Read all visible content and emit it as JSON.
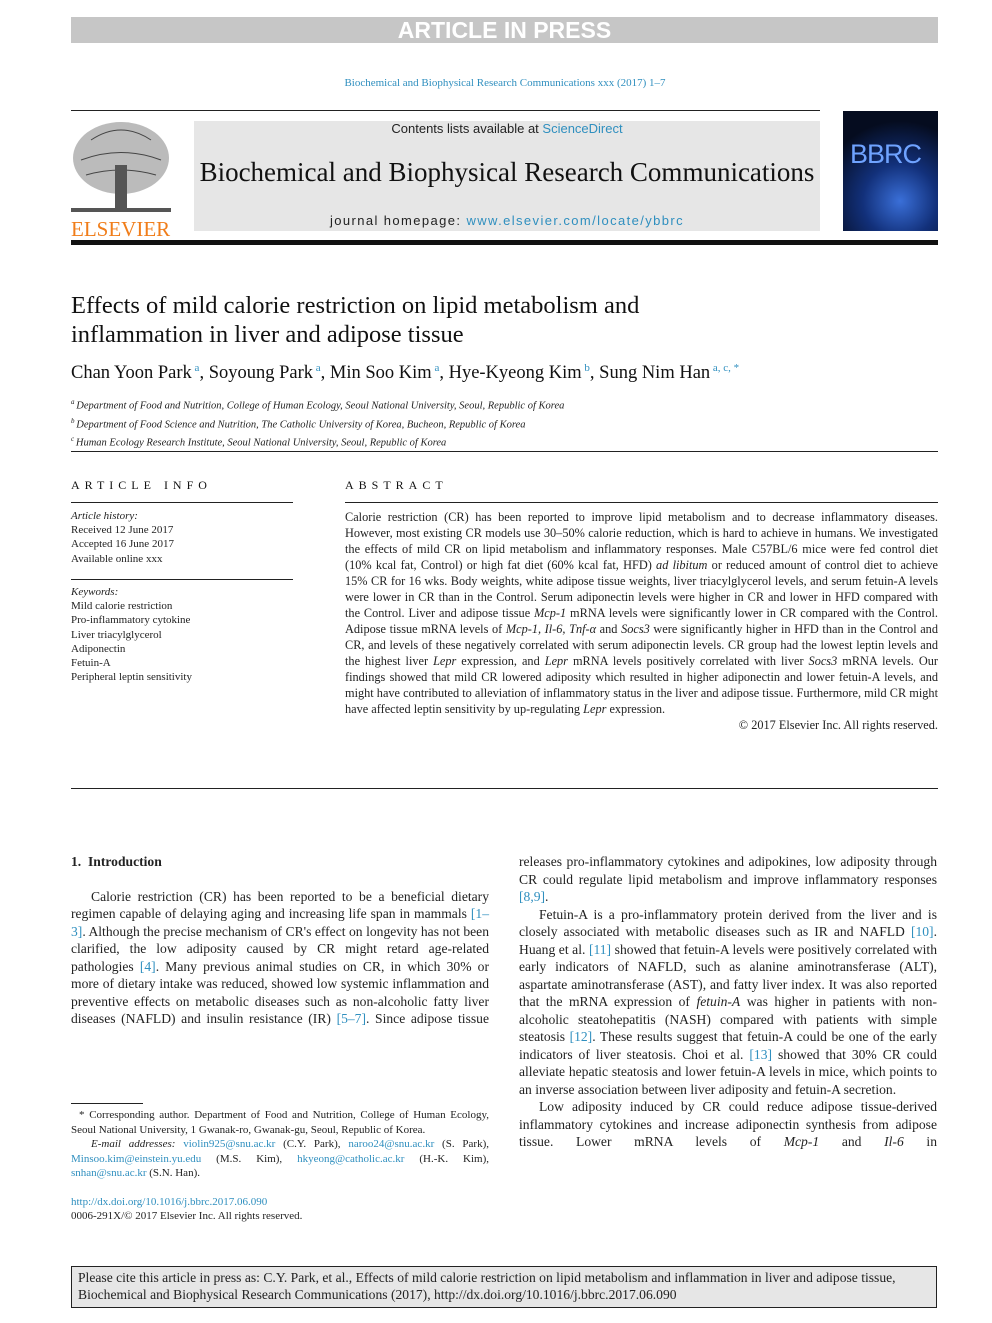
{
  "banner": {
    "article_in_press": "ARTICLE IN PRESS",
    "journal_ref": "Biochemical and Biophysical Research Communications xxx (2017) 1–7"
  },
  "masthead": {
    "contents_prefix": "Contents lists available at ",
    "sciencedirect": "ScienceDirect",
    "journal_title": "Biochemical and Biophysical Research Communications",
    "homepage_prefix": "journal homepage: ",
    "homepage_url": "www.elsevier.com/locate/ybbrc",
    "publisher_logo": "ELSEVIER",
    "cover_logo": "BBRC",
    "colors": {
      "link": "#2f8fbf",
      "elsevier": "#f07d1a"
    }
  },
  "article": {
    "title": "Effects of mild calorie restriction on lipid metabolism and inflammation in liver and adipose tissue",
    "authors": [
      {
        "name": "Chan Yoon Park",
        "aff": "a"
      },
      {
        "name": "Soyoung Park",
        "aff": "a"
      },
      {
        "name": "Min Soo Kim",
        "aff": "a"
      },
      {
        "name": "Hye-Kyeong Kim",
        "aff": "b"
      },
      {
        "name": "Sung Nim Han",
        "aff": "a, c, *"
      }
    ],
    "affiliations": [
      {
        "key": "a",
        "text": "Department of Food and Nutrition, College of Human Ecology, Seoul National University, Seoul, Republic of Korea"
      },
      {
        "key": "b",
        "text": "Department of Food Science and Nutrition, The Catholic University of Korea, Bucheon, Republic of Korea"
      },
      {
        "key": "c",
        "text": "Human Ecology Research Institute, Seoul National University, Seoul, Republic of Korea"
      }
    ]
  },
  "info": {
    "heading": "ARTICLE INFO",
    "history_label": "Article history:",
    "history": [
      "Received 12 June 2017",
      "Accepted 16 June 2017",
      "Available online xxx"
    ],
    "keywords_label": "Keywords:",
    "keywords": [
      "Mild calorie restriction",
      "Pro-inflammatory cytokine",
      "Liver triacylglycerol",
      "Adiponectin",
      "Fetuin-A",
      "Peripheral leptin sensitivity"
    ]
  },
  "abstract": {
    "heading": "ABSTRACT",
    "copyright": "© 2017 Elsevier Inc. All rights reserved.",
    "body": [
      [
        "t",
        "Calorie restriction (CR) has been reported to improve lipid metabolism and to decrease inflammatory diseases. However, most existing CR models use 30–50% calorie reduction, which is hard to achieve in humans. We investigated the effects of mild CR on lipid metabolism and inflammatory responses. Male C57BL/6 mice were fed control diet (10% kcal fat, Control) or high fat diet (60% kcal fat, HFD) "
      ],
      [
        "i",
        "ad libitum"
      ],
      [
        "t",
        " or reduced amount of control diet to achieve 15% CR for 16 wks. Body weights, white adipose tissue weights, liver triacylglycerol levels, and serum fetuin-A levels were lower in CR than in the Control. Serum adiponectin levels were higher in CR and lower in HFD compared with the Control. Liver and adipose tissue "
      ],
      [
        "i",
        "Mcp-1"
      ],
      [
        "t",
        " mRNA levels were significantly lower in CR compared with the Control. Adipose tissue mRNA levels of "
      ],
      [
        "i",
        "Mcp-1, Il-6, Tnf-α"
      ],
      [
        "t",
        " and "
      ],
      [
        "i",
        "Socs3"
      ],
      [
        "t",
        " were significantly higher in HFD than in the Control and CR, and levels of these negatively correlated with serum adiponectin levels. CR group had the lowest leptin levels and the highest liver "
      ],
      [
        "i",
        "Lepr"
      ],
      [
        "t",
        " expression, and "
      ],
      [
        "i",
        "Lepr"
      ],
      [
        "t",
        " mRNA levels positively correlated with liver "
      ],
      [
        "i",
        "Socs3"
      ],
      [
        "t",
        " mRNA levels. Our findings showed that mild CR lowered adiposity which resulted in higher adiponectin and lower fetuin-A levels, and might have contributed to alleviation of inflammatory status in the liver and adipose tissue. Furthermore, mild CR might have affected leptin sensitivity by up-regulating "
      ],
      [
        "i",
        "Lepr"
      ],
      [
        "t",
        " expression."
      ]
    ]
  },
  "intro": {
    "heading_num": "1.",
    "heading": "Introduction",
    "left_p1": [
      [
        "t",
        "Calorie restriction (CR) has been reported to be a beneficial dietary regimen capable of delaying aging and increasing life span in mammals "
      ],
      [
        "c",
        "[1–3]"
      ],
      [
        "t",
        ". Although the precise mechanism of CR's effect on longevity has not been clarified, the low adiposity caused by CR might retard age-related pathologies "
      ],
      [
        "c",
        "[4]"
      ],
      [
        "t",
        ". Many previous animal studies on CR, in which 30% or more of dietary intake was reduced, showed low systemic inflammation and preventive effects on metabolic diseases such as non-alcoholic fatty liver diseases (NAFLD) and insulin resistance (IR) "
      ],
      [
        "c",
        "[5–7]"
      ],
      [
        "t",
        ". Since adipose tissue"
      ]
    ],
    "right_p0": [
      [
        "t",
        "releases pro-inflammatory cytokines and adipokines, low adiposity through CR could regulate lipid metabolism and improve inflammatory responses "
      ],
      [
        "c",
        "[8,9]"
      ],
      [
        "t",
        "."
      ]
    ],
    "right_p1": [
      [
        "t",
        "Fetuin-A is a pro-inflammatory protein derived from the liver and is closely associated with metabolic diseases such as IR and NAFLD "
      ],
      [
        "c",
        "[10]"
      ],
      [
        "t",
        ". Huang et al. "
      ],
      [
        "c",
        "[11]"
      ],
      [
        "t",
        " showed that fetuin-A levels were positively correlated with early indicators of NAFLD, such as alanine aminotransferase (ALT), aspartate aminotransferase (AST), and fatty liver index. It was also reported that the mRNA expression of "
      ],
      [
        "i",
        "fetuin-A"
      ],
      [
        "t",
        " was higher in patients with non-alcoholic steatohepatitis (NASH) compared with patients with simple steatosis "
      ],
      [
        "c",
        "[12]"
      ],
      [
        "t",
        ". These results suggest that fetuin-A could be one of the early indicators of liver steatosis. Choi et al. "
      ],
      [
        "c",
        "[13]"
      ],
      [
        "t",
        " showed that 30% CR could alleviate hepatic steatosis and lower fetuin-A levels in mice, which points to an inverse association between liver adiposity and fetuin-A secretion."
      ]
    ],
    "right_p2": [
      [
        "t",
        "Low adiposity induced by CR could reduce adipose tissue-derived inflammatory cytokines and increase adiponectin synthesis from adipose tissue. Lower mRNA levels of "
      ],
      [
        "i",
        "Mcp-1"
      ],
      [
        "t",
        " and "
      ],
      [
        "i",
        "Il-6"
      ],
      [
        "t",
        " in"
      ]
    ]
  },
  "footnote": {
    "body": [
      [
        "t",
        "* Corresponding author. Department of Food and Nutrition, College of Human Ecology, Seoul National University, 1 Gwanak-ro, Gwanak-gu, Seoul, Republic of Korea."
      ]
    ],
    "emails": [
      [
        "i",
        "E-mail addresses: "
      ],
      [
        "c",
        "violin925@snu.ac.kr"
      ],
      [
        "t",
        " (C.Y. Park), "
      ],
      [
        "c",
        "naroo24@snu.ac.kr"
      ],
      [
        "t",
        " (S. Park), "
      ],
      [
        "c",
        "Minsoo.kim@einstein.yu.edu"
      ],
      [
        "t",
        " (M.S. Kim), "
      ],
      [
        "c",
        "hkyeong@catholic.ac.kr"
      ],
      [
        "t",
        " (H.-K. Kim), "
      ],
      [
        "c",
        "snhan@snu.ac.kr"
      ],
      [
        "t",
        " (S.N. Han)."
      ]
    ],
    "doi": "http://dx.doi.org/10.1016/j.bbrc.2017.06.090",
    "issn": "0006-291X/© 2017 Elsevier Inc. All rights reserved."
  },
  "citation_box": "Please cite this article in press as: C.Y. Park, et al., Effects of mild calorie restriction on lipid metabolism and inflammation in liver and adipose tissue, Biochemical and Biophysical Research Communications (2017), http://dx.doi.org/10.1016/j.bbrc.2017.06.090"
}
